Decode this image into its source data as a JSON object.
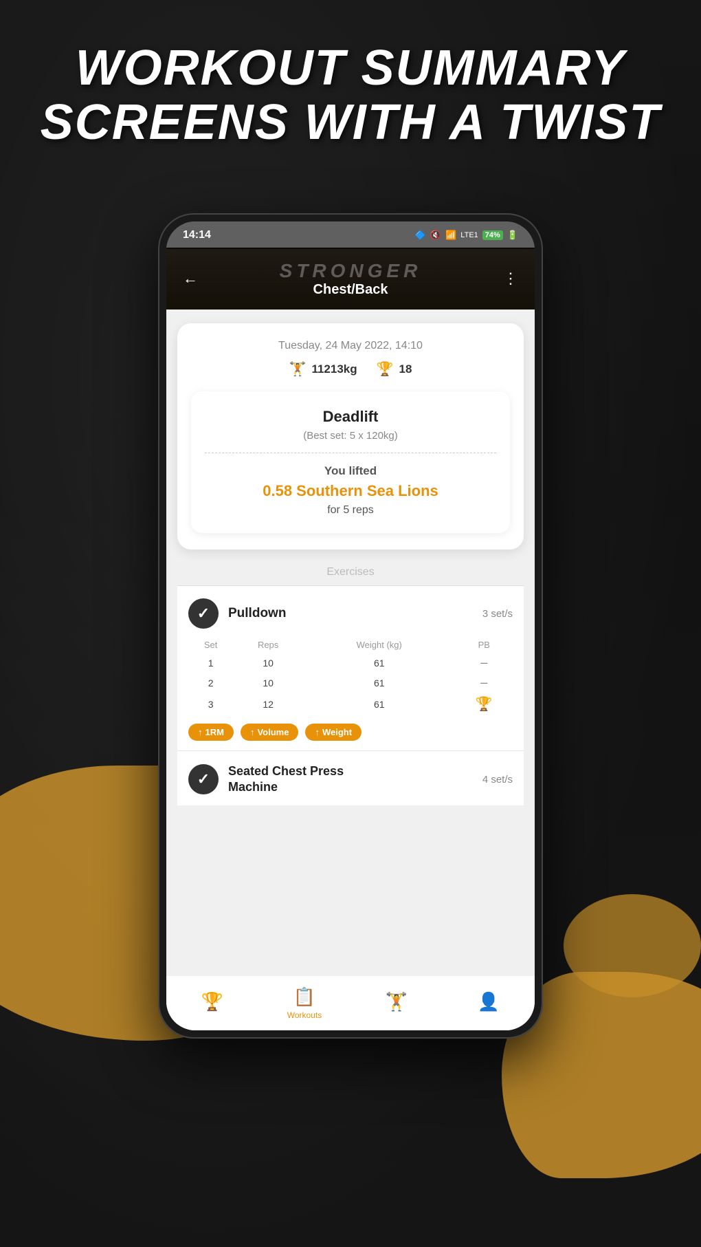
{
  "headline": {
    "line1": "WORKOUT SUMMARY",
    "line2": "SCREENS WITH A TWIST"
  },
  "phone": {
    "status_bar": {
      "time": "14:14",
      "icons": "🔇 📶 Vo0 LTE1",
      "battery": "74%"
    },
    "header": {
      "back_icon": "←",
      "app_name": "STRONGER",
      "workout_name": "Chest/Back",
      "menu_icon": "⋮"
    },
    "summary": {
      "date": "Tuesday, 24 May 2022, 14:10",
      "weight": "11213kg",
      "weight_icon": "🏋",
      "trophies": "18",
      "trophy_icon": "🏆"
    },
    "exercise_card": {
      "name": "Deadlift",
      "best_set": "(Best set: 5 x 120kg)",
      "you_lifted_label": "You lifted",
      "animal_text": "0.58 Southern Sea Lions",
      "for_reps": "for 5 reps"
    },
    "exercises_section": {
      "label": "Exercises",
      "items": [
        {
          "name": "Pulldown",
          "sets_label": "3 set/s",
          "columns": [
            "Set",
            "Reps",
            "Weight (kg)",
            "PB"
          ],
          "rows": [
            {
              "set": "1",
              "reps": "10",
              "weight": "61",
              "pb": "–",
              "pb_trophy": false
            },
            {
              "set": "2",
              "reps": "10",
              "weight": "61",
              "pb": "–",
              "pb_trophy": false
            },
            {
              "set": "3",
              "reps": "12",
              "weight": "61",
              "pb": "🏆",
              "pb_trophy": true
            }
          ],
          "badges": [
            "↑1RM",
            "↑Volume",
            "↑Weight"
          ]
        },
        {
          "name": "Seated Chest Press Machine",
          "sets_label": "4 set/s"
        }
      ]
    },
    "bottom_nav": {
      "items": [
        {
          "icon": "🏆",
          "label": "",
          "active": false
        },
        {
          "icon": "📋",
          "label": "Workouts",
          "active": true
        },
        {
          "icon": "🏋",
          "label": "",
          "active": false
        },
        {
          "icon": "👤",
          "label": "",
          "active": false
        }
      ]
    }
  }
}
